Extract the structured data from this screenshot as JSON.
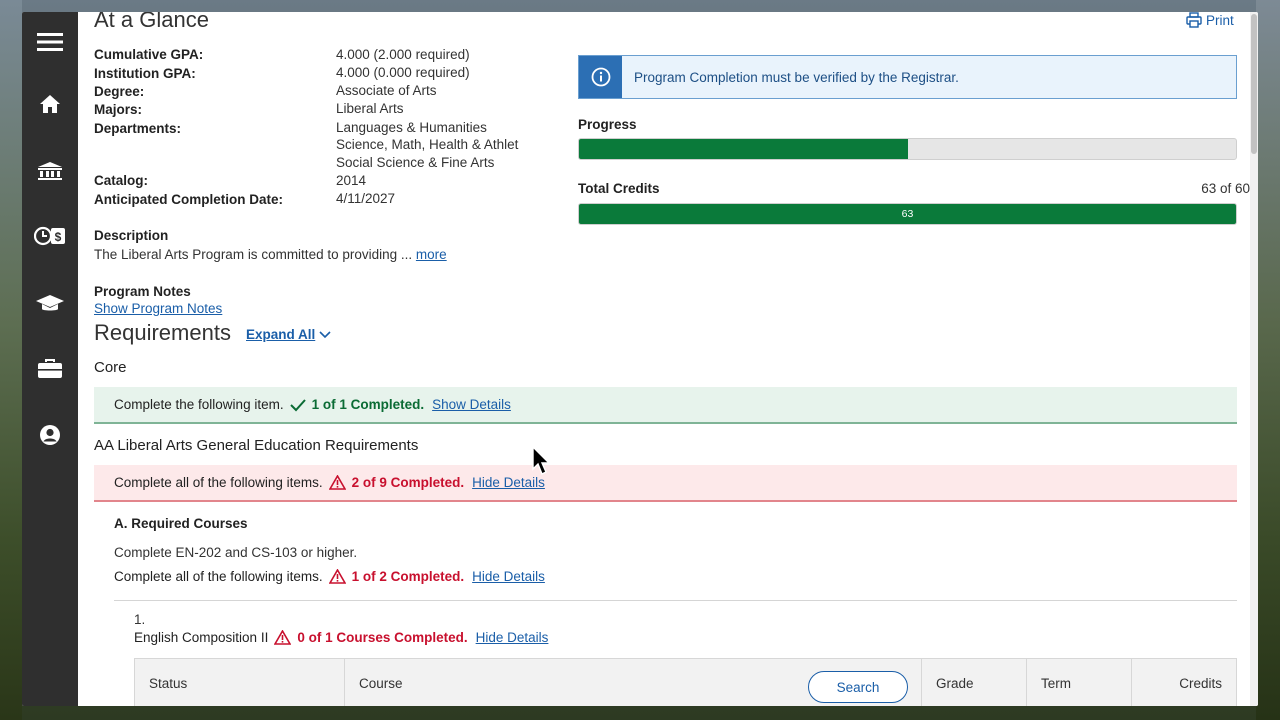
{
  "page": {
    "title": "At a Glance",
    "print_label": "Print"
  },
  "summary": [
    {
      "label": "Cumulative GPA:",
      "value": "4.000 (2.000 required)"
    },
    {
      "label": "Institution GPA:",
      "value": "4.000 (0.000 required)"
    },
    {
      "label": "Degree:",
      "value": "Associate of Arts"
    },
    {
      "label": "Majors:",
      "value": "Liberal Arts"
    },
    {
      "label": "Departments:",
      "values": [
        "Languages & Humanities",
        "Science, Math, Health & Athlet",
        "Social Science & Fine Arts"
      ]
    },
    {
      "label": "Catalog:",
      "value": "2014"
    },
    {
      "label": "Anticipated Completion Date:",
      "value": "4/11/2027"
    }
  ],
  "description": {
    "heading": "Description",
    "text": "The Liberal Arts Program is committed to providing ...",
    "more_link": "more"
  },
  "program_notes": {
    "heading": "Program Notes",
    "link": "Show Program Notes"
  },
  "alert": {
    "text": "Program Completion must be verified by the Registrar.",
    "icon": "info-icon"
  },
  "progress": {
    "label": "Progress",
    "fraction": 0.5
  },
  "total_credits": {
    "label": "Total Credits",
    "summary": "63 of 60",
    "value": "63",
    "fraction": 1.0
  },
  "requirements": {
    "heading": "Requirements",
    "expand_all": "Expand All",
    "core": {
      "title": "Core",
      "prefix": "Complete the following item.",
      "status": "1 of 1 Completed.",
      "link": "Show Details"
    },
    "ge": {
      "title": "AA Liberal Arts General Education Requirements",
      "prefix": "Complete all of the following items.",
      "status": "2 of 9 Completed.",
      "link": "Hide Details"
    },
    "section_a": {
      "title": "A. Required Courses",
      "note": "Complete EN-202 and CS-103 or higher.",
      "prefix": "Complete all of the following items.",
      "status": "1 of 2 Completed.",
      "link": "Hide Details"
    },
    "item_1": {
      "number": "1.",
      "name": "English Composition II",
      "status": "0 of 1 Courses Completed.",
      "link": "Hide Details"
    }
  },
  "table": {
    "columns": [
      "Status",
      "Course",
      "Grade",
      "Term",
      "Credits"
    ],
    "search_label": "Search"
  },
  "colors": {
    "sidebar": "#2f2f2f",
    "success": "#0a7a3a",
    "error": "#c8102e",
    "link": "#1a5ea8",
    "alert_accent": "#2c6fb4"
  },
  "nav_icons": [
    "menu-icon",
    "home-icon",
    "institution-icon",
    "finance-icon",
    "graduation-cap-icon",
    "briefcase-icon",
    "user-profile-icon"
  ]
}
